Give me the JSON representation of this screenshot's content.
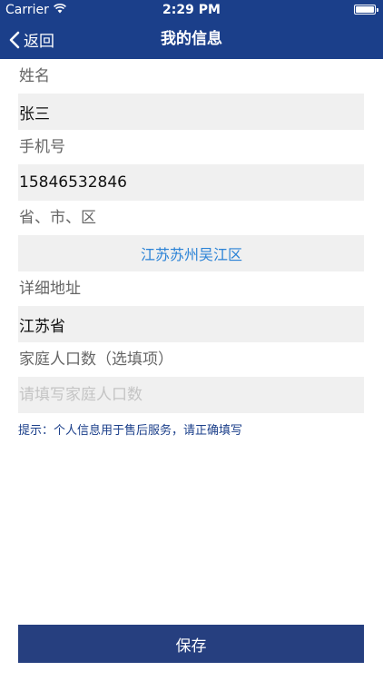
{
  "status_bar": {
    "carrier": "Carrier",
    "time": "2:29 PM"
  },
  "nav": {
    "back_label": "返回",
    "title": "我的信息"
  },
  "form": {
    "name": {
      "label": "姓名",
      "value": "张三"
    },
    "phone": {
      "label": "手机号",
      "value": "15846532846"
    },
    "region": {
      "label": "省、市、区",
      "value": "江苏苏州吴江区"
    },
    "address": {
      "label": "详细地址",
      "value": "江苏省"
    },
    "household": {
      "label": "家庭人口数（选填项）",
      "value": "",
      "placeholder": "请填写家庭人口数"
    }
  },
  "hint": "提示：个人信息用于售后服务，请正确填写",
  "save_label": "保存",
  "colors": {
    "nav_background": "#1b3f8a",
    "field_background": "#f0f0f0",
    "link": "#2a82d6",
    "button": "#263f7f"
  }
}
